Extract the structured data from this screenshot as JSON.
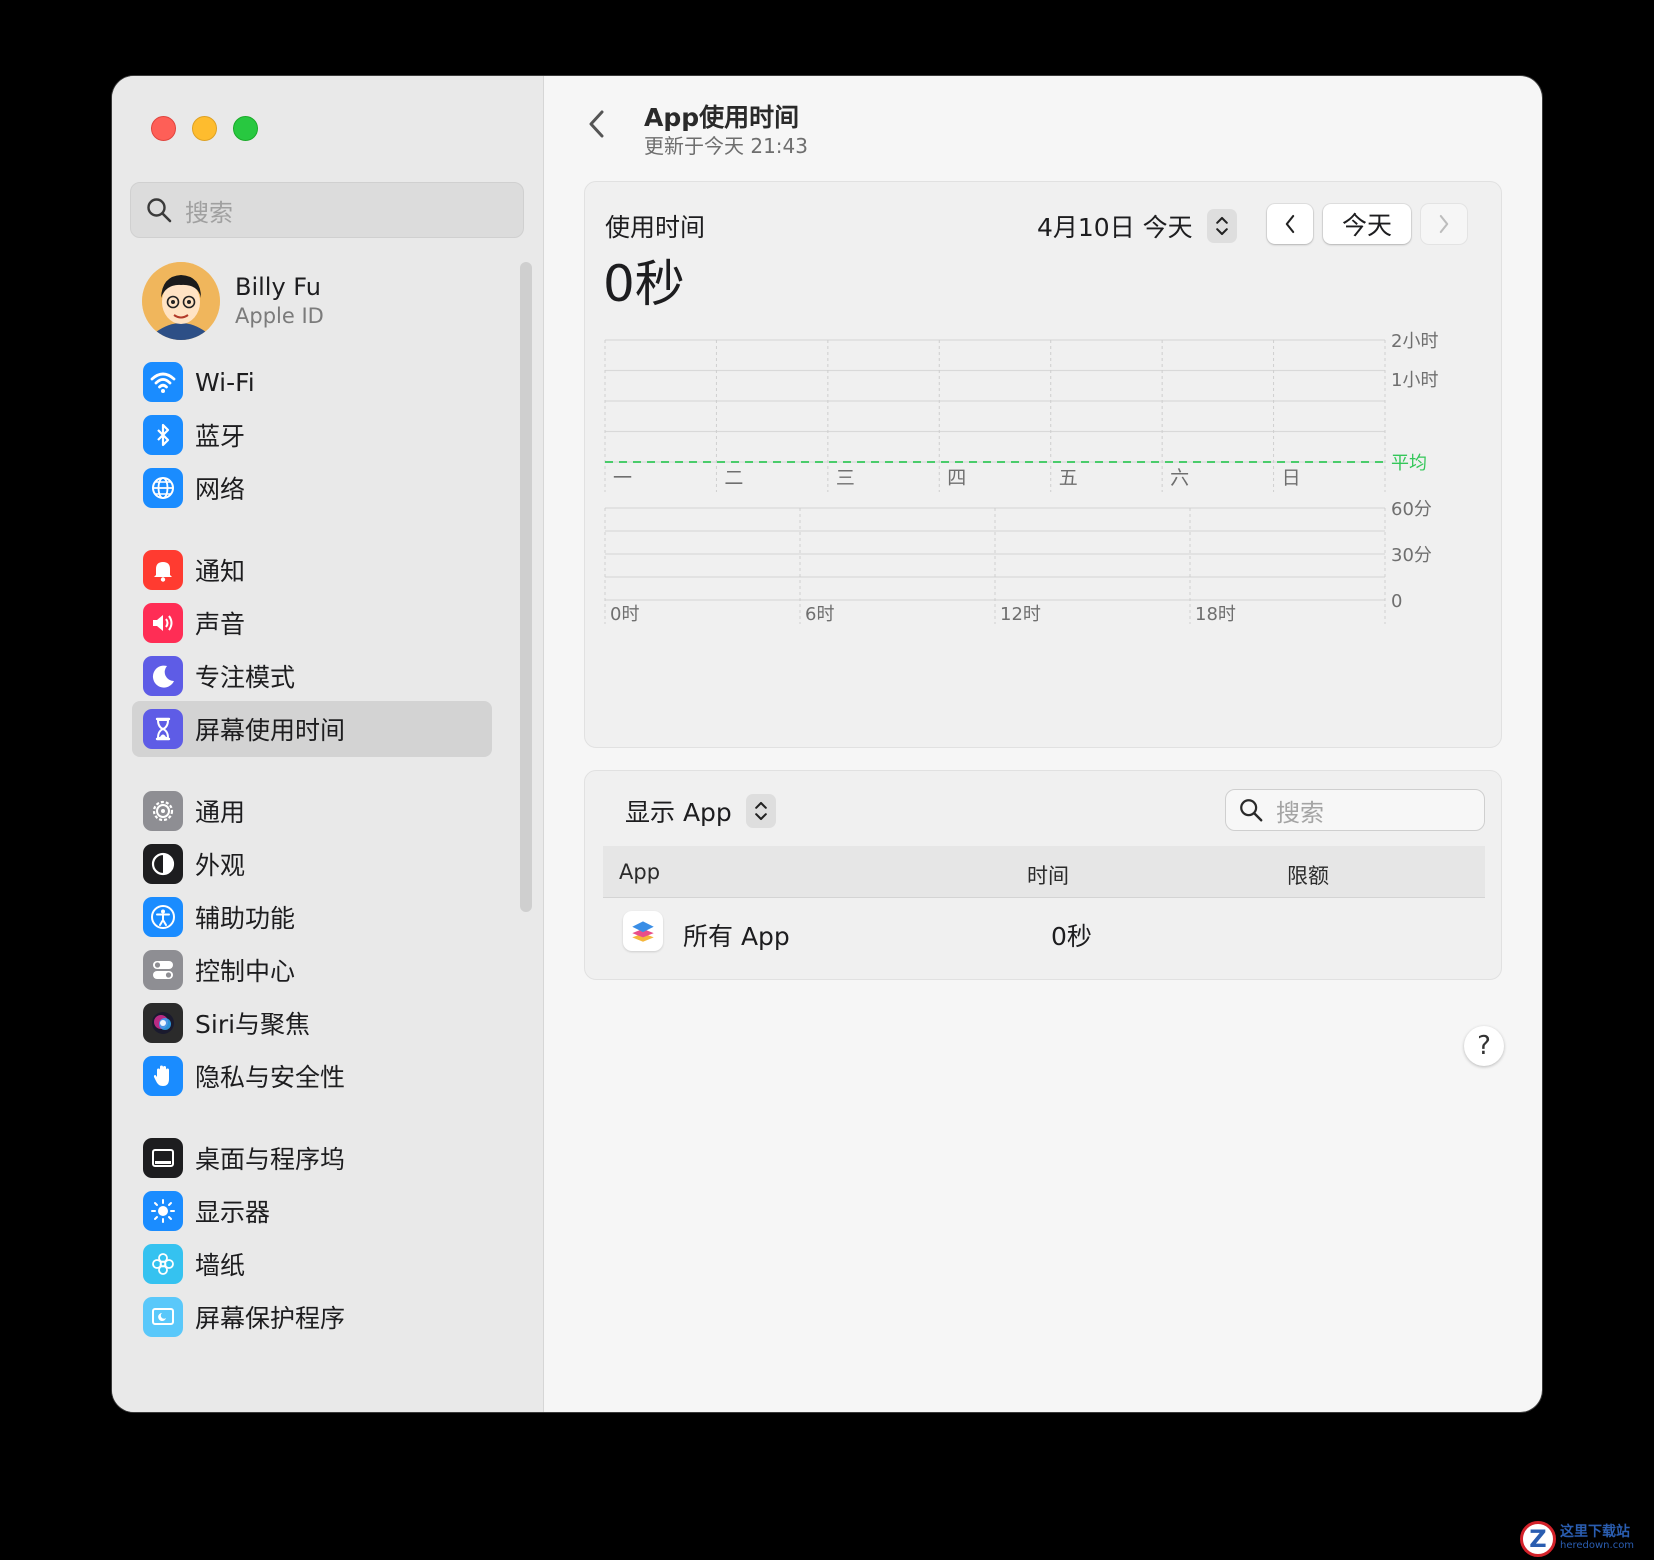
{
  "sidebar": {
    "search_placeholder": "搜索",
    "profile": {
      "name": "Billy Fu",
      "subtitle": "Apple ID"
    },
    "items": [
      {
        "label": "Wi-Fi",
        "icon": "wifi-icon",
        "color": "#1a8cff"
      },
      {
        "label": "蓝牙",
        "icon": "bluetooth-icon",
        "color": "#1a8cff"
      },
      {
        "label": "网络",
        "icon": "globe-icon",
        "color": "#1a8cff"
      },
      {
        "label": "通知",
        "icon": "bell-icon",
        "color": "#ff3b30"
      },
      {
        "label": "声音",
        "icon": "speaker-icon",
        "color": "#ff2d55"
      },
      {
        "label": "专注模式",
        "icon": "moon-icon",
        "color": "#5e5ce6"
      },
      {
        "label": "屏幕使用时间",
        "icon": "hourglass-icon",
        "color": "#5e5ce6",
        "active": true
      },
      {
        "label": "通用",
        "icon": "gear-icon",
        "color": "#8e8e93"
      },
      {
        "label": "外观",
        "icon": "appearance-icon",
        "color": "#1d1d1f"
      },
      {
        "label": "辅助功能",
        "icon": "accessibility-icon",
        "color": "#1a8cff"
      },
      {
        "label": "控制中心",
        "icon": "toggles-icon",
        "color": "#8e8e93"
      },
      {
        "label": "Siri与聚焦",
        "icon": "siri-icon",
        "color": "#2b2b2b"
      },
      {
        "label": "隐私与安全性",
        "icon": "hand-icon",
        "color": "#1a8cff"
      },
      {
        "label": "桌面与程序坞",
        "icon": "dock-icon",
        "color": "#1d1d1f"
      },
      {
        "label": "显示器",
        "icon": "sun-icon",
        "color": "#1a8cff"
      },
      {
        "label": "墙纸",
        "icon": "flower-icon",
        "color": "#35c2f0"
      },
      {
        "label": "屏幕保护程序",
        "icon": "screensaver-icon",
        "color": "#5ac8fa"
      }
    ]
  },
  "main": {
    "title": "App使用时间",
    "subtitle": "更新于今天 21:43",
    "usage_label": "使用时间",
    "usage_value": "0秒",
    "date_label": "4月10日 今天",
    "today_button": "今天"
  },
  "chart_data": [
    {
      "type": "bar",
      "categories": [
        "一",
        "二",
        "三",
        "四",
        "五",
        "六",
        "日"
      ],
      "values": [
        0,
        0,
        0,
        0,
        0,
        0,
        0
      ],
      "y_tick_labels": [
        "2小时",
        "1小时"
      ],
      "ylim": [
        0,
        2
      ],
      "average_label": "平均",
      "average_value": 0,
      "grid": true
    },
    {
      "type": "bar",
      "categories": [
        "0时",
        "6时",
        "12时",
        "18时"
      ],
      "values": [
        0,
        0,
        0,
        0
      ],
      "y_tick_labels": [
        "60分",
        "30分",
        "0"
      ],
      "ylim": [
        0,
        60
      ],
      "grid": true
    }
  ],
  "apps": {
    "filter_label": "显示 App",
    "search_placeholder": "搜索",
    "columns": [
      "App",
      "时间",
      "限额"
    ],
    "rows": [
      {
        "name": "所有 App",
        "time": "0秒",
        "limit": ""
      }
    ]
  },
  "help_label": "?",
  "watermark": {
    "cn": "这里下载站",
    "en": "heredown.com"
  }
}
